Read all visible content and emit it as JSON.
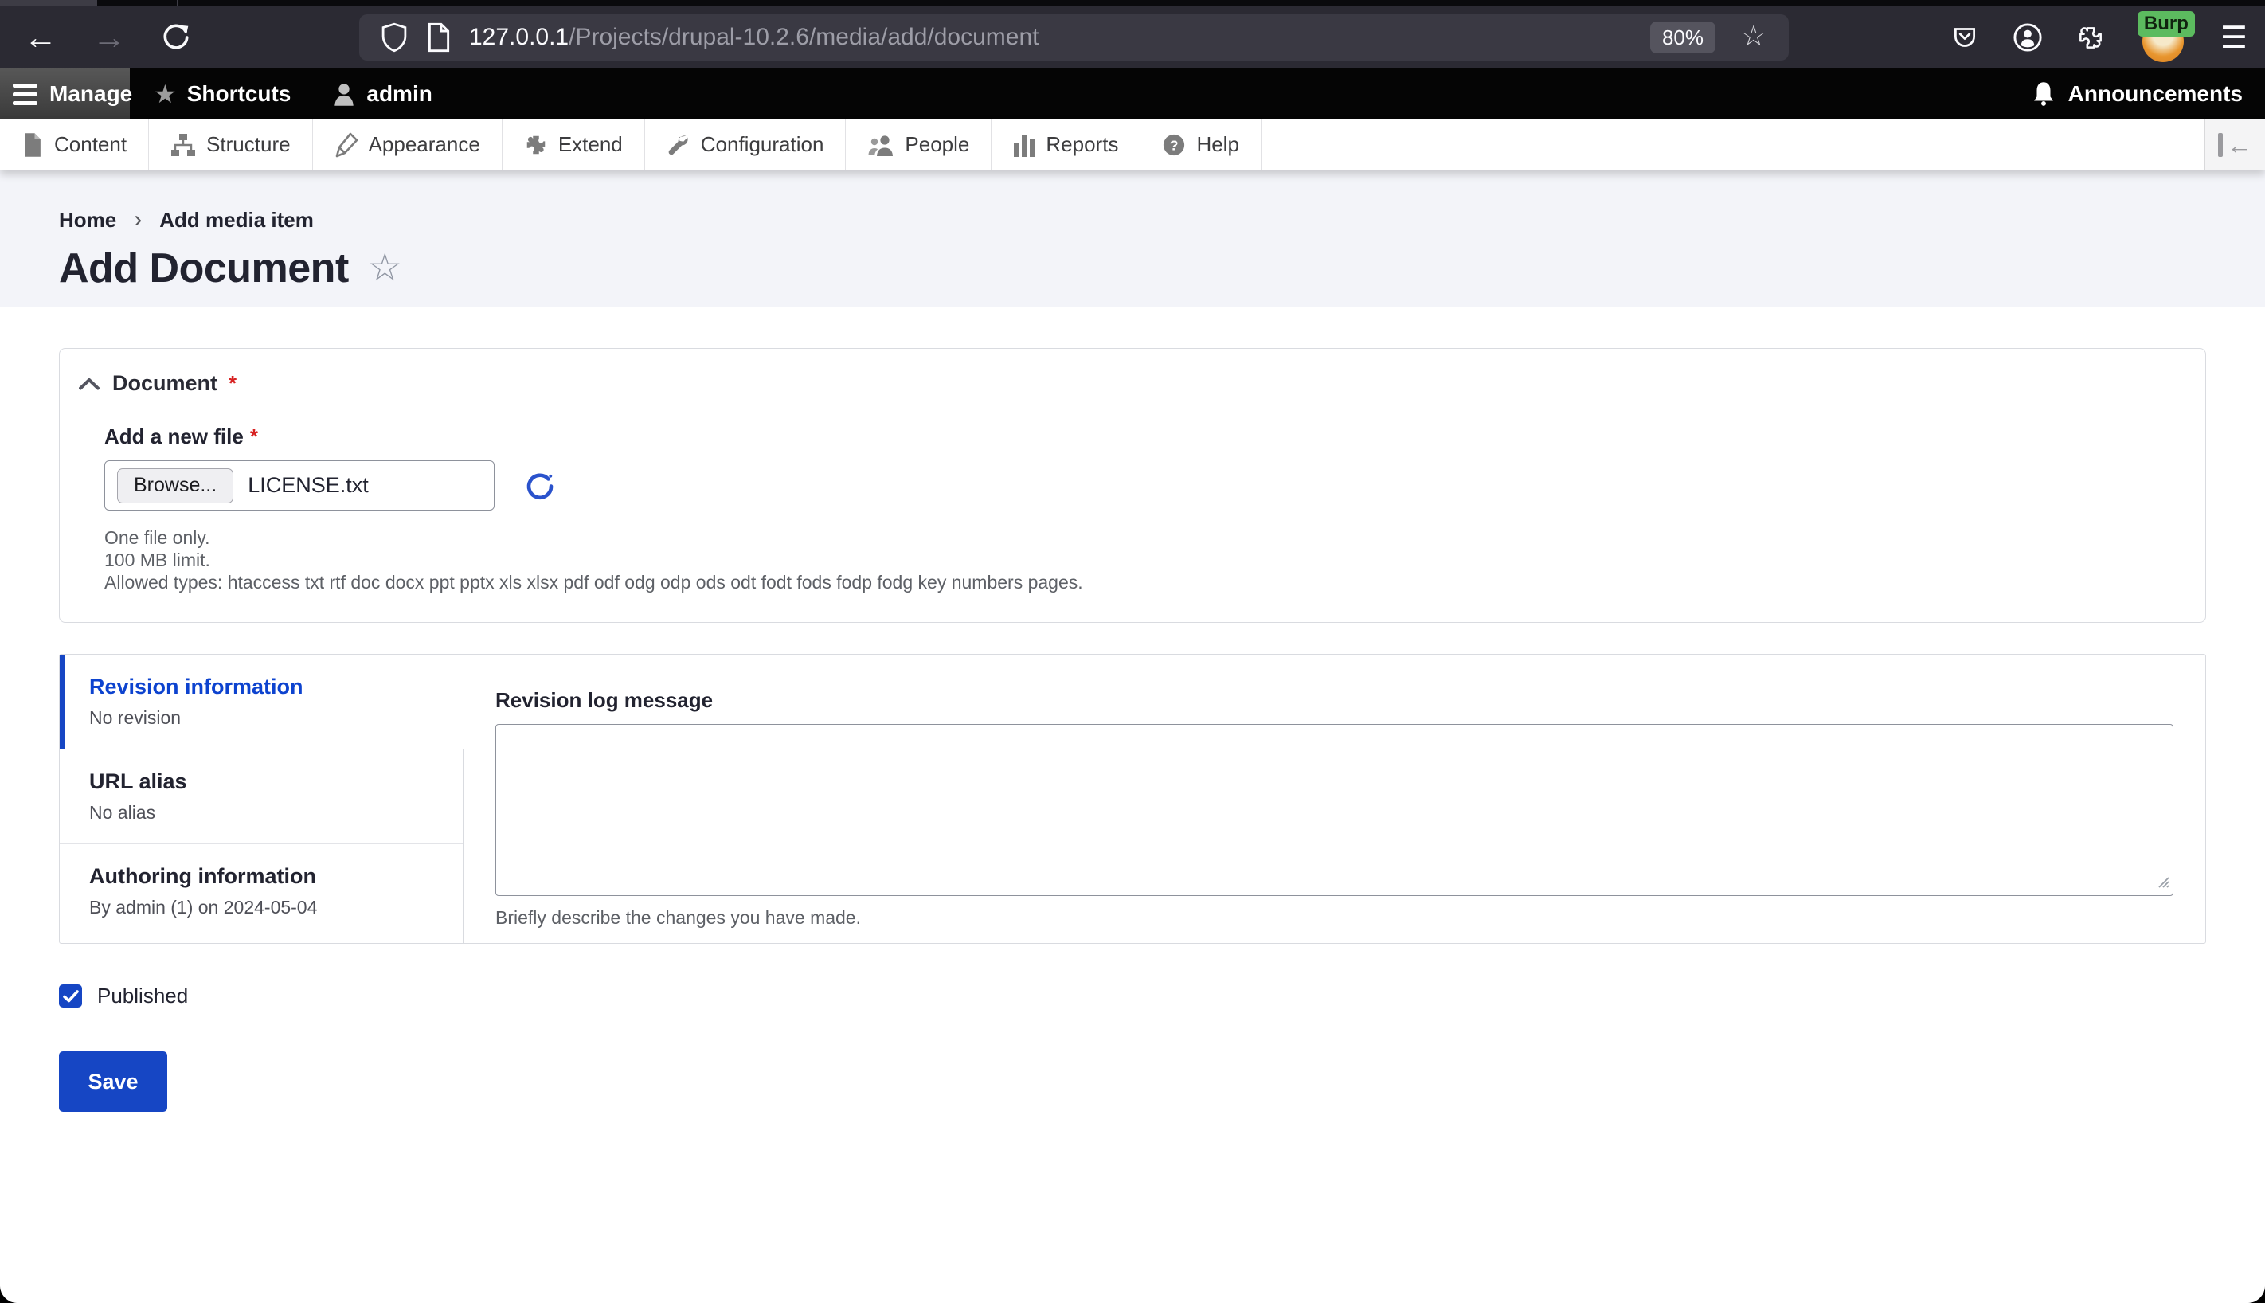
{
  "browser": {
    "url_host": "127.0.0.1",
    "url_path": "/Projects/drupal-10.2.6/media/add/document",
    "zoom_badge": "80%",
    "extension_badge": "Burp"
  },
  "admin_toolbar": {
    "manage": "Manage",
    "shortcuts": "Shortcuts",
    "user": "admin",
    "announcements": "Announcements"
  },
  "menu_bar": {
    "items": [
      {
        "label": "Content"
      },
      {
        "label": "Structure"
      },
      {
        "label": "Appearance"
      },
      {
        "label": "Extend"
      },
      {
        "label": "Configuration"
      },
      {
        "label": "People"
      },
      {
        "label": "Reports"
      },
      {
        "label": "Help"
      }
    ]
  },
  "breadcrumb": {
    "home": "Home",
    "separator": "›",
    "current": "Add media item"
  },
  "page": {
    "title": "Add Document"
  },
  "document_section": {
    "legend": "Document",
    "required_marker": "*",
    "file_label": "Add a new file",
    "browse_button": "Browse...",
    "filename": "LICENSE.txt",
    "help_lines": [
      "One file only.",
      "100 MB limit.",
      "Allowed types: htaccess txt rtf doc docx ppt pptx xls xlsx pdf odf odg odp ods odt fodt fods fodp fodg key numbers pages."
    ]
  },
  "vertical_tabs": [
    {
      "title": "Revision information",
      "summary": "No revision"
    },
    {
      "title": "URL alias",
      "summary": "No alias"
    },
    {
      "title": "Authoring information",
      "summary": "By admin (1) on 2024-05-04"
    }
  ],
  "revision_panel": {
    "label": "Revision log message",
    "description": "Briefly describe the changes you have made."
  },
  "publish": {
    "label": "Published",
    "checked": true
  },
  "actions": {
    "save": "Save"
  },
  "colors": {
    "primary_blue": "#1646c4",
    "tab_active_blue": "#0d43cf",
    "required_red": "#d72222",
    "header_bg": "#f3f4f9",
    "browser_toolbar": "#2b2a33",
    "admin_toolbar": "#050505",
    "extension_badge_green": "#5cbb5f"
  }
}
